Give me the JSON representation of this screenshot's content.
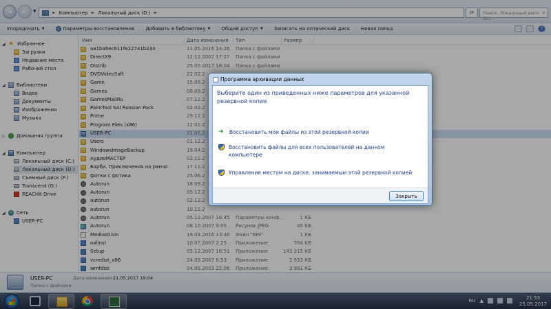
{
  "address": {
    "crumbs": [
      "Компьютер",
      "Локальный диск (D:)"
    ],
    "search_placeholder": "Поиск: Локальный диск (D:)"
  },
  "toolbar": {
    "items": [
      {
        "label": "Упорядочить",
        "dropdown": true
      },
      {
        "label": "Параметры восстановления",
        "icon": "gear-icon"
      },
      {
        "label": "Добавить в библиотеку",
        "dropdown": true
      },
      {
        "label": "Общий доступ",
        "dropdown": true
      },
      {
        "label": "Записать на оптический диск"
      },
      {
        "label": "Новая папка"
      }
    ]
  },
  "nav": {
    "favorites": "Избранное",
    "favorites_items": [
      "Загрузки",
      "Недавние места",
      "Рабочий стол"
    ],
    "libraries": "Библиотеки",
    "libraries_items": [
      "Видео",
      "Документы",
      "Изображения",
      "Музыка"
    ],
    "homegroup": "Домашняя группа",
    "computer": "Компьютер",
    "computer_items": [
      "Локальный диск (C:)",
      "Локальный диск (D:)",
      "Съемный диск (F:)",
      "Transcend (G:)",
      "REACHit Drive"
    ],
    "network": "Сеть",
    "network_items": [
      "USER-PC"
    ]
  },
  "columns": {
    "name": "Имя",
    "date": "Дата изменения",
    "type": "Тип",
    "size": "Размер"
  },
  "files": [
    {
      "name": "aa1ba8ec611fe22741b234",
      "date": "11.05.2016 14:26",
      "type": "Папка с файлами",
      "size": "",
      "icon": "folder"
    },
    {
      "name": "DirectX9",
      "date": "12.12.2007 17:27",
      "type": "Папка с файлами",
      "size": "",
      "icon": "folder"
    },
    {
      "name": "Distrib",
      "date": "25.05.2017 18:04",
      "type": "Папка с файлами",
      "size": "",
      "icon": "folder"
    },
    {
      "name": "DVDVideoSoft",
      "date": "22.02.2",
      "type": "",
      "size": "",
      "icon": "folder"
    },
    {
      "name": "Game",
      "date": "15.09.2",
      "type": "",
      "size": "",
      "icon": "folder"
    },
    {
      "name": "Games",
      "date": "08.09.2",
      "type": "",
      "size": "",
      "icon": "folder"
    },
    {
      "name": "GamesMailRu",
      "date": "07.12.2",
      "type": "",
      "size": "",
      "icon": "folder"
    },
    {
      "name": "PaintTool SAI Russian Pack",
      "date": "02.02.2",
      "type": "",
      "size": "",
      "icon": "folder"
    },
    {
      "name": "Prime",
      "date": "29.12.2",
      "type": "",
      "size": "",
      "icon": "folder"
    },
    {
      "name": "Program Files (x86)",
      "date": "12.01.2",
      "type": "",
      "size": "",
      "icon": "folder"
    },
    {
      "name": "USER-PC",
      "date": "21.05.2",
      "type": "",
      "size": "",
      "icon": "user-folder",
      "selected": true
    },
    {
      "name": "Users",
      "date": "01.12.2",
      "type": "",
      "size": "",
      "icon": "folder"
    },
    {
      "name": "WindowsImageBackup",
      "date": "19.04.2",
      "type": "",
      "size": "",
      "icon": "folder"
    },
    {
      "name": "АудиоМАСТЕР",
      "date": "02.12.2",
      "type": "",
      "size": "",
      "icon": "folder"
    },
    {
      "name": "Барби. Приключения на ранчо",
      "date": "17.11.2",
      "type": "",
      "size": "",
      "icon": "folder"
    },
    {
      "name": "фотки с фотика",
      "date": "25.06.2",
      "type": "",
      "size": "",
      "icon": "folder"
    },
    {
      "name": "Autorun",
      "date": "18.09.2",
      "type": "",
      "size": "",
      "icon": "gear"
    },
    {
      "name": "Autorun",
      "date": "05.12.2",
      "type": "",
      "size": "",
      "icon": "gear"
    },
    {
      "name": "autorun",
      "date": "02.12.2",
      "type": "",
      "size": "",
      "icon": "gear"
    },
    {
      "name": "autorun",
      "date": "10.12.2",
      "type": "",
      "size": "",
      "icon": "gear"
    },
    {
      "name": "Autorun",
      "date": "05.12.2007 16:45",
      "type": "Параметры конф...",
      "size": "1 КБ",
      "icon": "gear"
    },
    {
      "name": "Autorun",
      "date": "08.10.2007 9:05",
      "type": "Рисунок JPEG",
      "size": "45 КБ",
      "icon": "image"
    },
    {
      "name": "MediaID.bin",
      "date": "19.04.2016 13:48",
      "type": "Файл \"BIN\"",
      "size": "1 КБ",
      "icon": "file"
    },
    {
      "name": "oalinst",
      "date": "10.07.2007 2:25",
      "type": "Приложение",
      "size": "764 КБ",
      "icon": "app"
    },
    {
      "name": "Setup",
      "date": "05.12.2007 16:51",
      "type": "Приложение",
      "size": "143 215 КБ",
      "icon": "app"
    },
    {
      "name": "vcredist_x86",
      "date": "24.09.2007 6:53",
      "type": "Приложение",
      "size": "2 553 КБ",
      "icon": "app"
    },
    {
      "name": "wmfdist",
      "date": "04.09.2003 22:06",
      "type": "Приложение",
      "size": "3 991 КБ",
      "icon": "app"
    }
  ],
  "details": {
    "name": "USER-PC",
    "type": "Папка с файлами",
    "date_label": "Дата изменения:",
    "date_value": "21.05.2017 19:04"
  },
  "dialog": {
    "title": "Программа архивации данных",
    "heading": "Выберите один из приведенных ниже параметров для указанной резервной копии",
    "options": [
      {
        "label": "Восстановить мои файлы из этой резервной копии",
        "icon": "arrow-icon"
      },
      {
        "label": "Восстановить файлы для всех пользователей на данном компьютере",
        "icon": "shield-icon"
      },
      {
        "label": "Управление местом на диске, занимаемым этой резервной копией",
        "icon": "shield-icon"
      }
    ],
    "close_label": "Закрыть"
  },
  "taskbar": {
    "lang": "RU",
    "time": "21:53",
    "date": "25.05.2017"
  }
}
